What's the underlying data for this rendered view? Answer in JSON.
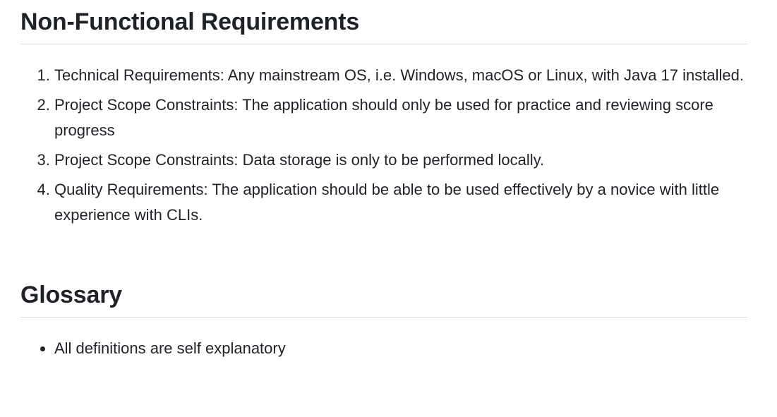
{
  "sections": {
    "nonfunctional": {
      "heading": "Non-Functional Requirements",
      "items": [
        "Technical Requirements: Any mainstream OS, i.e. Windows, macOS or Linux, with Java 17 installed.",
        "Project Scope Constraints: The application should only be used for practice and reviewing score progress",
        "Project Scope Constraints: Data storage is only to be performed locally.",
        "Quality Requirements: The application should be able to be used effectively by a novice with little experience with CLIs."
      ]
    },
    "glossary": {
      "heading": "Glossary",
      "items": [
        "All definitions are self explanatory"
      ]
    }
  }
}
